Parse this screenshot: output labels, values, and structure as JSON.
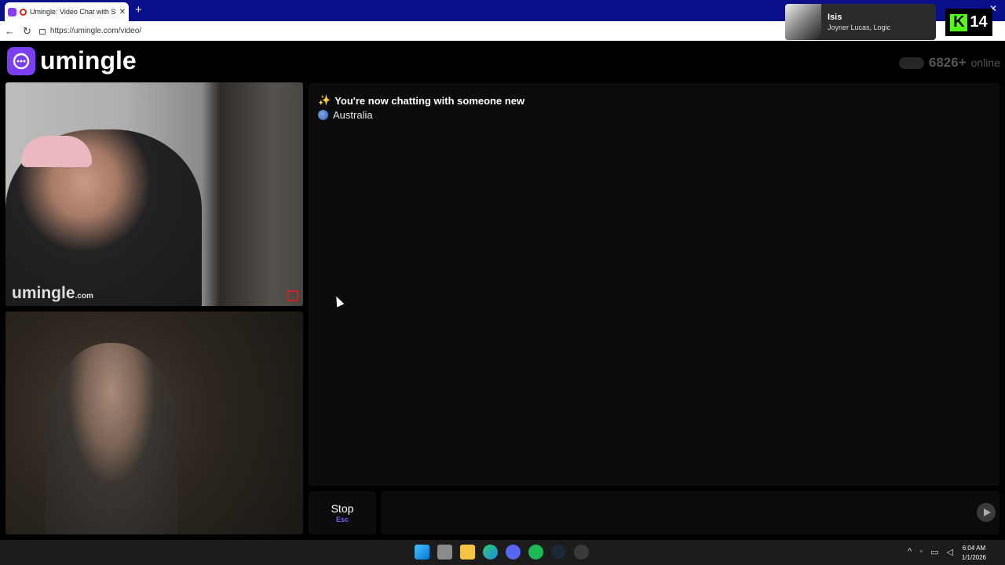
{
  "browser": {
    "tab_title": "Umingle: Video Chat with Stra",
    "tab_close": "✕",
    "new_tab": "+",
    "window_close": "✕",
    "url": "https://umingle.com/video/"
  },
  "now_playing": {
    "song": "Isis",
    "artist": "Joyner Lucas, Logic"
  },
  "kick": {
    "logo_letter": "K",
    "count": "14"
  },
  "site": {
    "logo_text": "umingle",
    "online_count": "6826+",
    "online_label": "online"
  },
  "video": {
    "watermark": "umingle",
    "watermark_suffix": ".com"
  },
  "chat": {
    "status_message": "You're now chatting with someone new",
    "status_emoji": "✨",
    "country": "Australia",
    "input_value": ""
  },
  "controls": {
    "stop_label": "Stop",
    "stop_shortcut": "Esc"
  },
  "taskbar": {
    "time": "6:04 AM",
    "date": "1/1/2026"
  },
  "colors": {
    "accent": "#7b3ff2",
    "kick_green": "#53fc18",
    "tab_bar": "#0a0f8a"
  }
}
